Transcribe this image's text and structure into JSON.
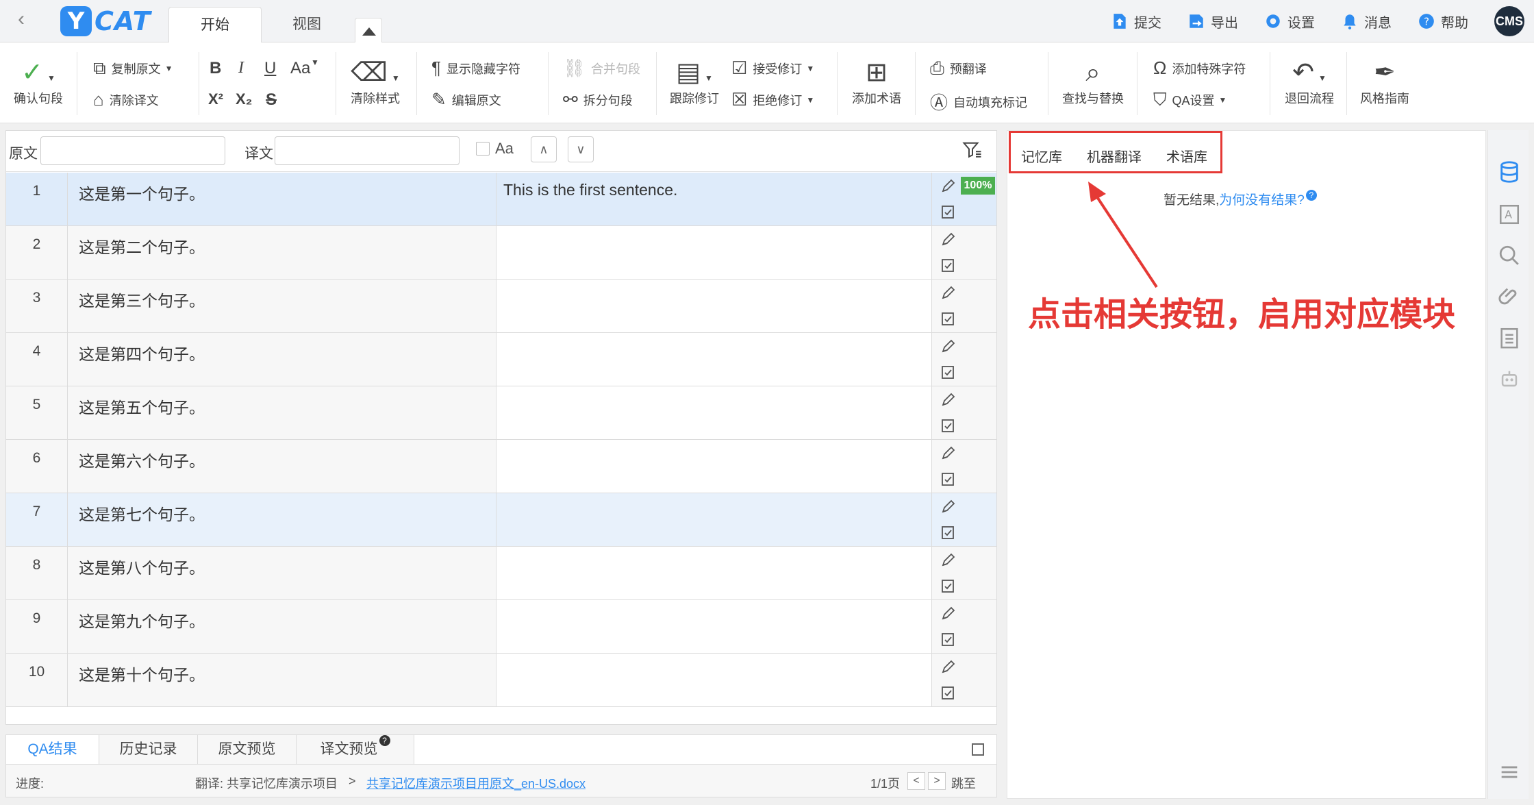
{
  "app": {
    "logo_y": "Y",
    "logo_text": "CAT"
  },
  "top_tabs": {
    "start": "开始",
    "view": "视图"
  },
  "top_actions": {
    "submit": "提交",
    "export": "导出",
    "settings": "设置",
    "messages": "消息",
    "help": "帮助",
    "user": "CMS"
  },
  "ribbon": {
    "confirm": "确认句段",
    "copy_source": "复制原文",
    "clear_target": "清除译文",
    "fmt_bold": "B",
    "fmt_italic": "I",
    "fmt_underline": "U",
    "fmt_case": "Aa",
    "fmt_sup": "X²",
    "fmt_sub": "X₂",
    "fmt_strike": "S",
    "clear_style": "清除样式",
    "show_hidden": "显示隐藏字符",
    "edit_source": "编辑原文",
    "merge": "合并句段",
    "split": "拆分句段",
    "track": "跟踪修订",
    "accept": "接受修订",
    "reject": "拒绝修订",
    "add_term": "添加术语",
    "pretranslate": "预翻译",
    "autofill": "自动填充标记",
    "find_replace": "查找与替换",
    "special_char": "添加特殊字符",
    "qa_settings": "QA设置",
    "rollback": "退回流程",
    "style_guide": "风格指南"
  },
  "filter": {
    "source_label": "原文",
    "target_label": "译文",
    "case_label": "Aa",
    "up": "∧",
    "down": "∨"
  },
  "segments": [
    {
      "num": "1",
      "source": "这是第一个句子。",
      "target": "This is the first sentence.",
      "match": "100%"
    },
    {
      "num": "2",
      "source": "这是第二个句子。",
      "target": ""
    },
    {
      "num": "3",
      "source": "这是第三个句子。",
      "target": ""
    },
    {
      "num": "4",
      "source": "这是第四个句子。",
      "target": ""
    },
    {
      "num": "5",
      "source": "这是第五个句子。",
      "target": ""
    },
    {
      "num": "6",
      "source": "这是第六个句子。",
      "target": ""
    },
    {
      "num": "7",
      "source": "这是第七个句子。",
      "target": ""
    },
    {
      "num": "8",
      "source": "这是第八个句子。",
      "target": ""
    },
    {
      "num": "9",
      "source": "这是第九个句子。",
      "target": ""
    },
    {
      "num": "10",
      "source": "这是第十个句子。",
      "target": ""
    }
  ],
  "bottom_tabs": {
    "qa": "QA结果",
    "history": "历史记录",
    "src_preview": "原文预览",
    "tgt_preview": "译文预览",
    "help_mark": "?"
  },
  "status": {
    "progress": "进度:",
    "translate_prefix": "翻译: 共享记忆库演示项目",
    "sep": ">",
    "file": "共享记忆库演示项目用原文_en-US.docx",
    "page": "1/1页",
    "prev": "<",
    "next": ">",
    "goto": "跳至"
  },
  "right_panel": {
    "tabs": {
      "memory": "记忆库",
      "mt": "机器翻译",
      "termbase": "术语库"
    },
    "no_result": "暂无结果,",
    "why_link": "为何没有结果?",
    "help_mark": "?",
    "annotation": "点击相关按钮，启用对应模块"
  },
  "colors": {
    "accent": "#2f8cf0",
    "annotation_red": "#e53935",
    "match_green": "#4caf50",
    "row_highlight": "#deebfa"
  }
}
